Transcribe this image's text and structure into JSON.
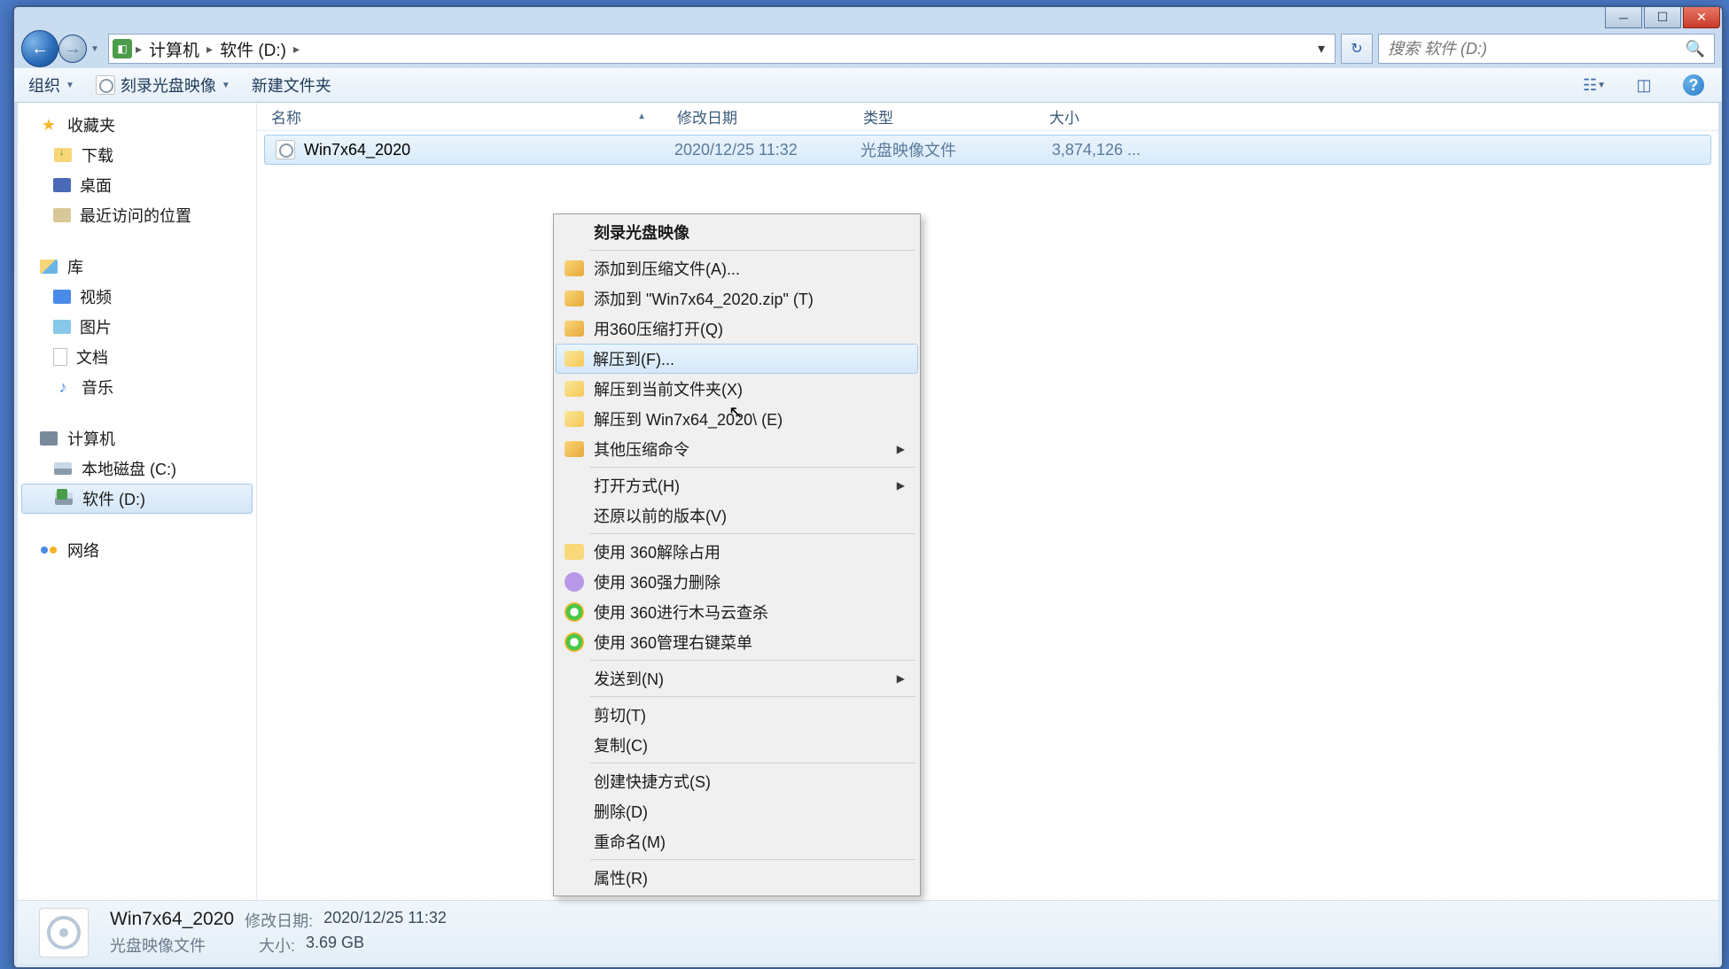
{
  "window": {
    "breadcrumb": [
      "计算机",
      "软件 (D:)"
    ],
    "search_placeholder": "搜索 软件 (D:)"
  },
  "toolbar": {
    "organize": "组织",
    "burn": "刻录光盘映像",
    "new_folder": "新建文件夹"
  },
  "sidebar": {
    "favorites": {
      "label": "收藏夹",
      "items": [
        "下载",
        "桌面",
        "最近访问的位置"
      ]
    },
    "libraries": {
      "label": "库",
      "items": [
        "视频",
        "图片",
        "文档",
        "音乐"
      ]
    },
    "computer": {
      "label": "计算机",
      "items": [
        "本地磁盘 (C:)",
        "软件 (D:)"
      ]
    },
    "network": {
      "label": "网络"
    }
  },
  "columns": {
    "name": "名称",
    "date": "修改日期",
    "type": "类型",
    "size": "大小"
  },
  "file": {
    "name": "Win7x64_2020",
    "date": "2020/12/25 11:32",
    "type": "光盘映像文件",
    "size": "3,874,126 ..."
  },
  "context_menu": {
    "burn": "刻录光盘映像",
    "add_archive": "添加到压缩文件(A)...",
    "add_zip": "添加到 \"Win7x64_2020.zip\" (T)",
    "open_360zip": "用360压缩打开(Q)",
    "extract_to": "解压到(F)...",
    "extract_here": "解压到当前文件夹(X)",
    "extract_named": "解压到 Win7x64_2020\\ (E)",
    "other_zip": "其他压缩命令",
    "open_with": "打开方式(H)",
    "restore": "还原以前的版本(V)",
    "unlock_360": "使用 360解除占用",
    "force_del_360": "使用 360强力删除",
    "scan_360": "使用 360进行木马云查杀",
    "manage_360": "使用 360管理右键菜单",
    "send_to": "发送到(N)",
    "cut": "剪切(T)",
    "copy": "复制(C)",
    "shortcut": "创建快捷方式(S)",
    "delete": "删除(D)",
    "rename": "重命名(M)",
    "properties": "属性(R)"
  },
  "statusbar": {
    "name": "Win7x64_2020",
    "type": "光盘映像文件",
    "date_label": "修改日期:",
    "date": "2020/12/25 11:32",
    "size_label": "大小:",
    "size": "3.69 GB"
  }
}
